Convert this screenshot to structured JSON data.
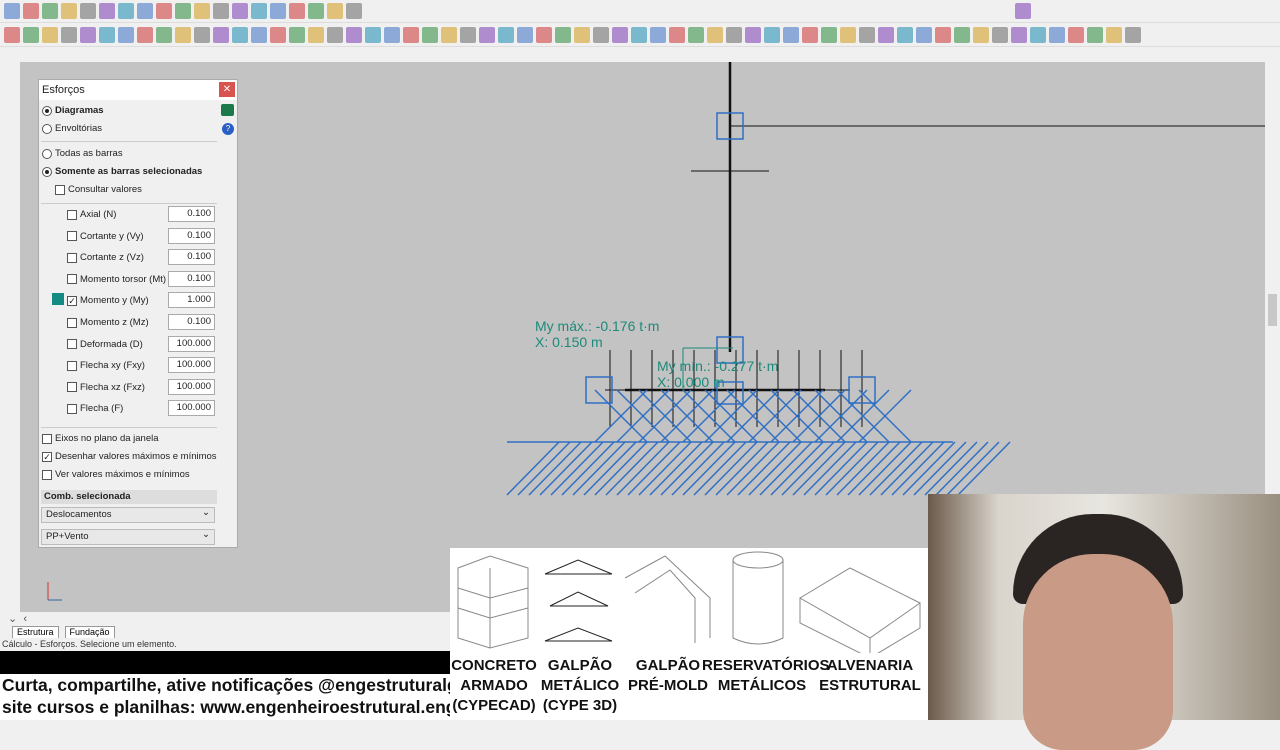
{
  "toolbar_icons": [
    "save",
    "print",
    "undo",
    "redo",
    "zoom",
    "pan",
    "select",
    "move",
    "copy",
    "rotate",
    "grid",
    "snap",
    "measure",
    "view-3d"
  ],
  "panel": {
    "title": "Esforços",
    "mode_diagramas": "Diagramas",
    "mode_envoltorias": "Envoltórias",
    "todas_barras": "Todas as barras",
    "somente_selecionadas": "Somente as barras selecionadas",
    "consultar": "Consultar valores",
    "items": [
      {
        "label": "Axial (N)",
        "value": "0.100",
        "checked": false
      },
      {
        "label": "Cortante y (Vy)",
        "value": "0.100",
        "checked": false
      },
      {
        "label": "Cortante z (Vz)",
        "value": "0.100",
        "checked": false
      },
      {
        "label": "Momento torsor (Mt)",
        "value": "0.100",
        "checked": false
      },
      {
        "label": "Momento y (My)",
        "value": "1.000",
        "checked": true
      },
      {
        "label": "Momento z (Mz)",
        "value": "0.100",
        "checked": false
      },
      {
        "label": "Deformada (D)",
        "value": "100.000",
        "checked": false
      },
      {
        "label": "Flecha xy (Fxy)",
        "value": "100.000",
        "checked": false
      },
      {
        "label": "Flecha xz (Fxz)",
        "value": "100.000",
        "checked": false
      },
      {
        "label": "Flecha (F)",
        "value": "100.000",
        "checked": false
      }
    ],
    "eixos": "Eixos no plano da janela",
    "desenhar": "Desenhar valores máximos e mínimos",
    "ver": "Ver valores máximos e mínimos",
    "comb_header": "Comb. selecionada",
    "comb1": "Deslocamentos",
    "comb2": "PP+Vento",
    "my_color": "#138a82"
  },
  "canvas": {
    "max_label": "My máx.: -0.176 t·m",
    "max_x": "X: 0.150 m",
    "min_label": "My mín.: -0.277 t·m",
    "min_x": "X: 0.000 m"
  },
  "tabs": [
    "Estrutura",
    "Fundação"
  ],
  "status": "Cálculo - Esforços. Selecione um elemento.",
  "promo": {
    "line1": "Curta, compartilhe, ative notificações @engestruturalgilberto",
    "line2": "site cursos e planilhas: www.engenheiroestrutural.eng.br"
  },
  "banner": [
    {
      "l1": "CONCRETO",
      "l2": "ARMADO",
      "l3": "(CYPECAD)"
    },
    {
      "l1": "GALPÃO",
      "l2": "METÁLICO",
      "l3": "(CYPE 3D)"
    },
    {
      "l1": "GALPÃO",
      "l2": "PRÉ-MOLD",
      "l3": ""
    },
    {
      "l1": "RESERVATÓRIOS",
      "l2": "METÁLICOS",
      "l3": ""
    },
    {
      "l1": "ALVENARIA",
      "l2": "ESTRUTURAL",
      "l3": ""
    }
  ]
}
